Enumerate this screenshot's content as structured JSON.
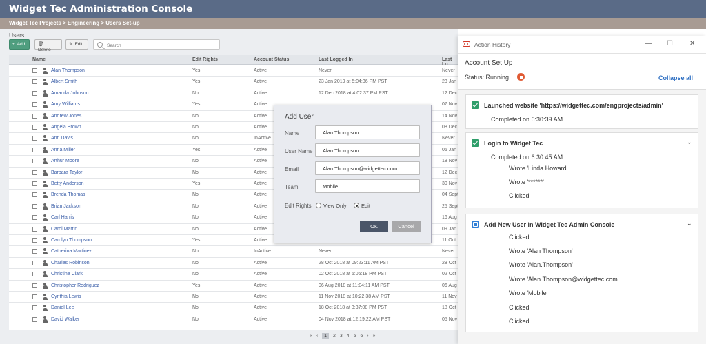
{
  "app": {
    "title": "Widget Tec Administration Console"
  },
  "breadcrumb": "Widget Tec Projects > Engineering > Users Set-up",
  "users_label": "Users",
  "toolbar": {
    "add_label": "Add",
    "delete_label": "Delete",
    "edit_label": "Edit",
    "search_placeholder": "Search"
  },
  "table": {
    "columns": [
      "Name",
      "Edit Rights",
      "Account Status",
      "Last Logged In",
      "Last Lo"
    ],
    "rows": [
      {
        "name": "Alan Thompson",
        "rights": "Yes",
        "status": "Active",
        "last": "Never",
        "last2": "Never"
      },
      {
        "name": "Albert Smith",
        "rights": "Yes",
        "status": "Active",
        "last": "23 Jan 2019 at 5:04:36 PM PST",
        "last2": "23 Jan 2"
      },
      {
        "name": "Amanda Johnson",
        "rights": "No",
        "status": "Active",
        "last": "12 Dec 2018 at 4:02:37 PM PST",
        "last2": "12 Dec"
      },
      {
        "name": "Amy Williams",
        "rights": "Yes",
        "status": "Active",
        "last": "",
        "last2": "07 Nov"
      },
      {
        "name": "Andrew Jones",
        "rights": "No",
        "status": "Active",
        "last": "",
        "last2": "14 Nov"
      },
      {
        "name": "Angela Brown",
        "rights": "No",
        "status": "Active",
        "last": "",
        "last2": "08 Dec"
      },
      {
        "name": "Ann Davis",
        "rights": "No",
        "status": "InActive",
        "last": "",
        "last2": "Never"
      },
      {
        "name": "Anna Miller",
        "rights": "Yes",
        "status": "Active",
        "last": "",
        "last2": "05 Jan 2"
      },
      {
        "name": "Arthur Moore",
        "rights": "No",
        "status": "Active",
        "last": "",
        "last2": "18 Nov"
      },
      {
        "name": "Barbara Taylor",
        "rights": "No",
        "status": "Active",
        "last": "",
        "last2": "12 Dec"
      },
      {
        "name": "Betty Anderson",
        "rights": "Yes",
        "status": "Active",
        "last": "",
        "last2": "30 Nov"
      },
      {
        "name": "Brenda Thomas",
        "rights": "No",
        "status": "Active",
        "last": "",
        "last2": "04 Sept"
      },
      {
        "name": "Brian Jackson",
        "rights": "No",
        "status": "Active",
        "last": "",
        "last2": "25 Sept"
      },
      {
        "name": "Carl Harris",
        "rights": "No",
        "status": "Active",
        "last": "",
        "last2": "16 Aug"
      },
      {
        "name": "Carol Martin",
        "rights": "No",
        "status": "Active",
        "last": "",
        "last2": "09 Jan 2"
      },
      {
        "name": "Carolyn Thompson",
        "rights": "Yes",
        "status": "Active",
        "last": "",
        "last2": "11 Oct"
      },
      {
        "name": "Catherina Martinez",
        "rights": "No",
        "status": "InActive",
        "last": "Never",
        "last2": "Never"
      },
      {
        "name": "Charles Robinson",
        "rights": "No",
        "status": "Active",
        "last": "28 Oct 2018 at 09:23:11 AM PST",
        "last2": "28 Oct"
      },
      {
        "name": "Christine Clark",
        "rights": "No",
        "status": "Active",
        "last": "02 Oct 2018 at 5:06:18 PM PST",
        "last2": "02 Oct"
      },
      {
        "name": "Christopher Rodriguez",
        "rights": "Yes",
        "status": "Active",
        "last": "06 Aug 2018 at 11:04:11 AM PST",
        "last2": "06 Aug"
      },
      {
        "name": "Cynthia Lewis",
        "rights": "No",
        "status": "Active",
        "last": "11 Nov 2018 at 10:22:38 AM PST",
        "last2": "11 Nov"
      },
      {
        "name": "Daniel Lee",
        "rights": "No",
        "status": "Active",
        "last": "18 Oct 2018 at 3:37:08 PM PST",
        "last2": "18 Oct"
      },
      {
        "name": "David Walker",
        "rights": "No",
        "status": "Active",
        "last": "04 Nov 2018 at 12:19:22 AM PST",
        "last2": "05 Nov"
      }
    ]
  },
  "pager": {
    "first": "«",
    "prev": "‹",
    "pages": [
      "1",
      "2",
      "3",
      "4",
      "5",
      "6"
    ],
    "next": "›",
    "last": "»"
  },
  "dialog": {
    "title": "Add User",
    "name_label": "Name",
    "name_value": "Alan Thompson",
    "username_label": "User Name",
    "username_value": "Alan.Thompson",
    "email_label": "Email",
    "email_value": "Alan.Thompson@widgettec.com",
    "team_label": "Team",
    "team_value": "Mobile",
    "rights_label": "Edit Rights",
    "view_only": "View Only",
    "edit": "Edit",
    "ok": "OK",
    "cancel": "Cancel"
  },
  "panel": {
    "title": "Action History",
    "account": "Account Set Up",
    "status": "Status:  Running",
    "collapse": "Collapse all",
    "cards": [
      {
        "title": "Launched website 'https://widgettec.com/engprojects/admin'",
        "lines": [
          "Completed on 6:30:39 AM"
        ]
      },
      {
        "title": "Login to Widget Tec",
        "lines": [
          "Completed on 6:30:45 AM",
          "Wrote 'Linda.Howard'",
          "Wrote '******'",
          "Clicked"
        ]
      },
      {
        "title": "Add New User in Widget Tec Admin Console",
        "lines": [
          "Clicked",
          "Wrote 'Alan Thompson'",
          "Wrote 'Alan.Thompson'",
          "Wrote 'Alan.Thompson@widgettec.com'",
          "Wrote 'Mobile'",
          "Clicked",
          "Clicked"
        ]
      }
    ]
  }
}
